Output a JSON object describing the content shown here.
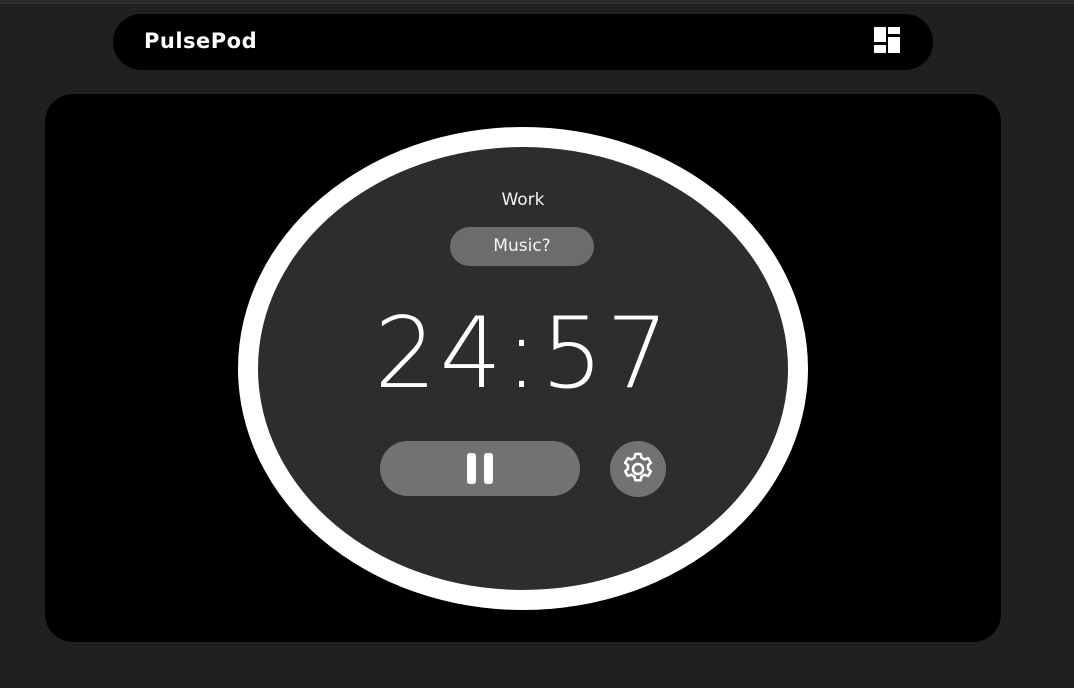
{
  "app": {
    "brand": "PulsePod"
  },
  "nav": {
    "layout_icon": "dashboard-layout-icon"
  },
  "timer": {
    "mode": "Work",
    "music_label": "Music?",
    "time": "24:57",
    "pause_icon": "pause-icon",
    "settings_icon": "gear-icon"
  },
  "colors": {
    "page_bg": "#202020",
    "panel_bg": "#000000",
    "ring": "#ffffff",
    "ring_fill": "#2d2d2d",
    "button_bg": "#727272",
    "music_bg": "#6c6c6c",
    "text": "#ffffff"
  }
}
